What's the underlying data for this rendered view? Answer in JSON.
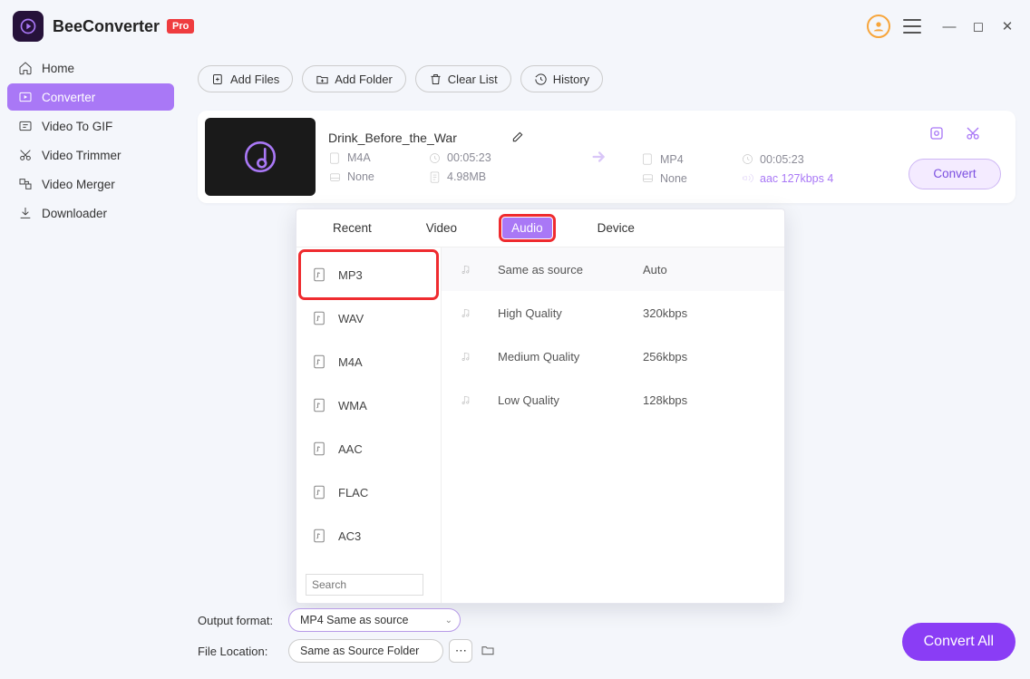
{
  "app": {
    "title": "BeeConverter",
    "badge": "Pro"
  },
  "sidebar": {
    "items": [
      {
        "label": "Home"
      },
      {
        "label": "Converter"
      },
      {
        "label": "Video To GIF"
      },
      {
        "label": "Video Trimmer"
      },
      {
        "label": "Video Merger"
      },
      {
        "label": "Downloader"
      }
    ]
  },
  "toolbar": {
    "add_files": "Add Files",
    "add_folder": "Add Folder",
    "clear_list": "Clear List",
    "history": "History"
  },
  "file": {
    "title": "Drink_Before_the_War",
    "src_format": "M4A",
    "duration": "00:05:23",
    "subtitle": "None",
    "size": "4.98MB",
    "out_format": "MP4",
    "out_duration": "00:05:23",
    "out_subtitle": "None",
    "out_audio": "aac 127kbps 4",
    "convert": "Convert"
  },
  "popup": {
    "tabs": {
      "recent": "Recent",
      "video": "Video",
      "audio": "Audio",
      "device": "Device"
    },
    "formats": [
      {
        "label": "MP3"
      },
      {
        "label": "WAV"
      },
      {
        "label": "M4A"
      },
      {
        "label": "WMA"
      },
      {
        "label": "AAC"
      },
      {
        "label": "FLAC"
      },
      {
        "label": "AC3"
      }
    ],
    "search_placeholder": "Search",
    "qualities": [
      {
        "label": "Same as source",
        "rate": "Auto"
      },
      {
        "label": "High Quality",
        "rate": "320kbps"
      },
      {
        "label": "Medium Quality",
        "rate": "256kbps"
      },
      {
        "label": "Low Quality",
        "rate": "128kbps"
      }
    ]
  },
  "footer": {
    "output_label": "Output format:",
    "output_value": "MP4 Same as source",
    "location_label": "File Location:",
    "location_value": "Same as Source Folder",
    "convert_all": "Convert All"
  }
}
